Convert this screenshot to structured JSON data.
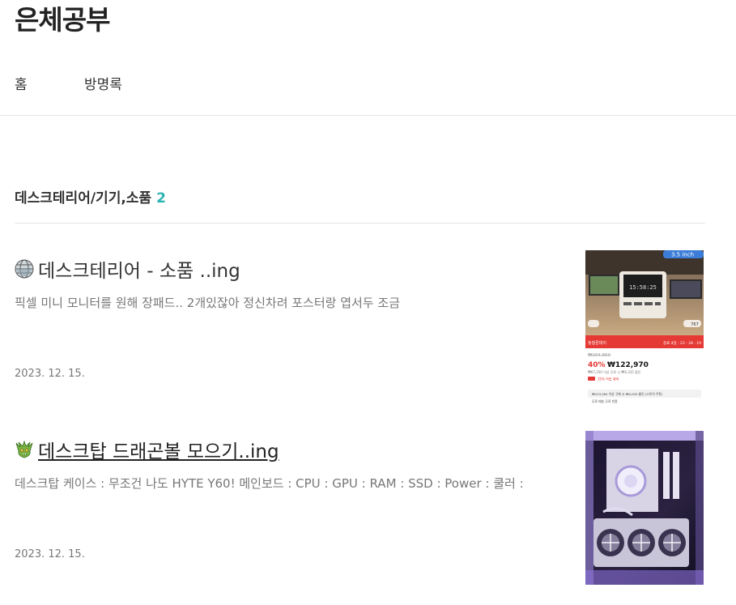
{
  "blog": {
    "title": "은체공부"
  },
  "nav": {
    "items": [
      {
        "label": "홈"
      },
      {
        "label": "방명록"
      }
    ]
  },
  "category": {
    "name": "데스크테리어/기기,소품",
    "count": "2"
  },
  "posts": [
    {
      "emoji": "globe-icon",
      "title": "데스크테리어 - 소품 ..ing",
      "excerpt": "픽셀 미니 모니터를 원해 장패드.. 2개있잖아 정신차려 포스터랑 엽서두 조금",
      "date": "2023. 12. 15.",
      "thumb": {
        "badge": "3.5 inch",
        "clock": "15:58:25",
        "banner_left": "놓칠폰데이",
        "banner_right": "종료 4일 : 23 : 28 : 19",
        "old_price": "₩204,950",
        "discount": "40%",
        "price": "₩122,970",
        "line1": "₩67,250 이상 무료 시 ₩4,335 할인",
        "line2": "35% 적립 혜택",
        "line3": "₩103,084 이상 구매 시 ₩4,000 할인 (스토어 쿠폰)",
        "line4": "무료 배송 무료 반품",
        "likes": "767"
      }
    },
    {
      "emoji": "dragon-icon",
      "title": "데스크탑 드래곤볼 모으기..ing",
      "excerpt": "데스크탑 케이스 : 무조건 나도 HYTE Y60! 메인보드 : CPU : GPU : RAM : SSD : Power : 쿨러 :",
      "date": "2023. 12. 15."
    }
  ],
  "colors": {
    "accent": "#2bb3b1",
    "banner": "#e53935",
    "badge": "#3b7dd8"
  }
}
